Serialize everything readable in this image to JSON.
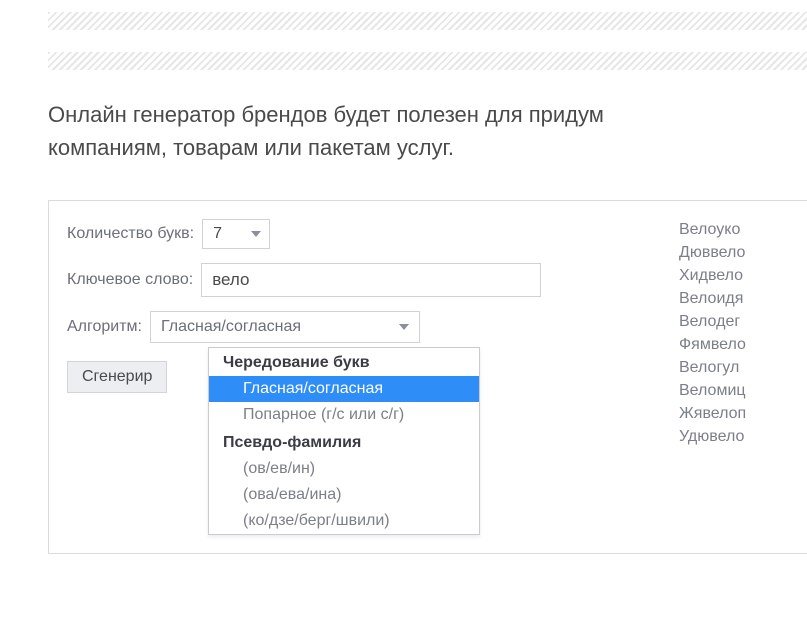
{
  "description": {
    "line1": "Онлайн генератор брендов будет полезен для придум",
    "line2": "компаниям, товарам или пакетам услуг."
  },
  "form": {
    "letters_label": "Количество букв:",
    "letters_value": "7",
    "keyword_label": "Ключевое слово:",
    "keyword_value": "вело",
    "algorithm_label": "Алгоритм:",
    "algorithm_value": "Гласная/согласная",
    "generate_label": "Сгенерир"
  },
  "dropdown": {
    "group1_label": "Чередование букв",
    "group1_options": [
      "Гласная/согласная",
      "Попарное (г/с или с/г)"
    ],
    "group2_label": "Псевдо-фамилия",
    "group2_options": [
      "(ов/ев/ин)",
      "(ова/ева/ина)",
      "(ко/дзе/берг/швили)"
    ],
    "selected": "Гласная/согласная"
  },
  "results": [
    "Велоуко",
    "Дюввело",
    "Хидвело",
    "Велоидя",
    "Велодег",
    "Фямвело",
    "Велогул",
    "Веломиц",
    "Жявелоп",
    "Удювело"
  ]
}
